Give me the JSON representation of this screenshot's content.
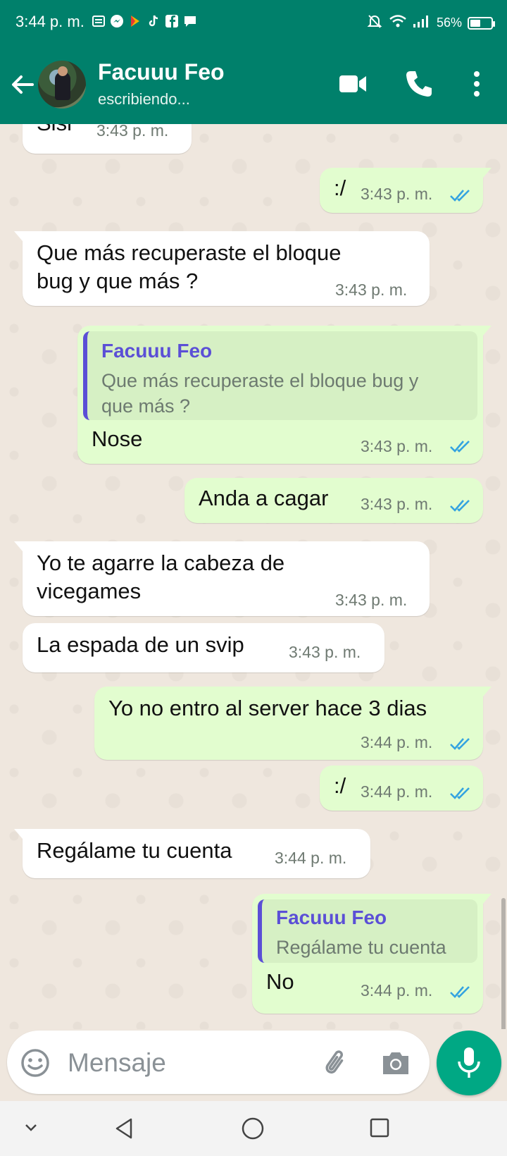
{
  "status_bar": {
    "time": "3:44 p. m.",
    "battery": "56%",
    "battery_level": 0.56
  },
  "header": {
    "contact_name": "Facuuu Feo",
    "contact_status": "escribiendo..."
  },
  "messages": [
    {
      "text": "Sisi",
      "time": "3:43 p. m."
    },
    {
      "text": ":/",
      "time": "3:43 p. m."
    },
    {
      "line1": "Que más recuperaste el bloque",
      "line2": "bug y que más ?",
      "time": "3:43 p. m."
    },
    {
      "quote_name": "Facuuu Feo",
      "quote_line1": "Que más recuperaste el bloque bug y",
      "quote_line2": "que más ?",
      "text": "Nose",
      "time": "3:43 p. m."
    },
    {
      "text": "Anda  a cagar",
      "time": "3:43 p. m."
    },
    {
      "line1": "Yo te agarre la cabeza de",
      "line2": "vicegames",
      "time": "3:43 p. m."
    },
    {
      "text": "La espada de un svip",
      "time": "3:43 p. m."
    },
    {
      "text": "Yo no entro al server hace 3 dias",
      "time": "3:44 p. m."
    },
    {
      "text": ":/",
      "time": "3:44 p. m."
    },
    {
      "text": "Regálame tu cuenta",
      "time": "3:44 p. m."
    },
    {
      "quote_name": "Facuuu Feo",
      "quote_text": "Regálame tu cuenta",
      "text": "No",
      "time": "3:44 p. m."
    }
  ],
  "composer": {
    "placeholder": "Mensaje"
  },
  "colors": {
    "header": "#00806b",
    "outgoing_bubble": "#e2fdcf",
    "incoming_bubble": "#ffffff",
    "read_ticks": "#34a3e0",
    "quote_accent": "#5b4fd6",
    "mic_button": "#00a884"
  },
  "icons": {
    "header": [
      "back-arrow-icon",
      "video-call-icon",
      "phone-icon",
      "more-options-icon"
    ],
    "composer": [
      "emoji-icon",
      "attach-icon",
      "camera-icon",
      "mic-icon"
    ],
    "navigation": [
      "collapse-icon",
      "back-icon",
      "home-icon",
      "recents-icon"
    ]
  }
}
